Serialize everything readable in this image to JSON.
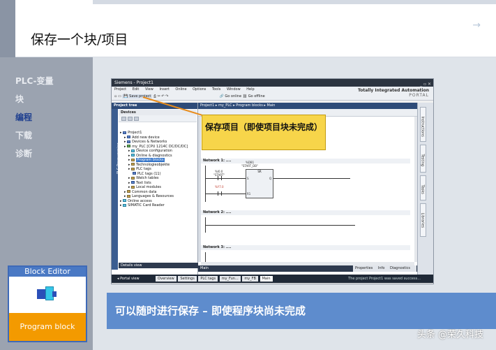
{
  "slide": {
    "title": "保存一个块/项目",
    "caption": "可以随时进行保存 – 即使程序块尚未完成",
    "watermark": "头条 @荣久科技"
  },
  "nav": {
    "items": [
      {
        "label": "PLC-变量",
        "active": false
      },
      {
        "label": "块",
        "active": false
      },
      {
        "label": "编程",
        "active": true
      },
      {
        "label": "下载",
        "active": false
      },
      {
        "label": "诊断",
        "active": false
      }
    ]
  },
  "block_card": {
    "title": "Block  Editor",
    "footer": "Program block"
  },
  "callout": {
    "text": "保存项目（即使项目块未完成）"
  },
  "tia": {
    "window_title": "Siemens - Project1",
    "menu": [
      "Project",
      "Edit",
      "View",
      "Insert",
      "Online",
      "Options",
      "Tools",
      "Window",
      "Help"
    ],
    "brand_line1": "Totally Integrated Automation",
    "brand_line2": "PORTAL",
    "toolbar": {
      "save_project": "Save project",
      "go_online": "Go online",
      "go_offline": "Go offline"
    },
    "project_tree_header": "Project tree",
    "devices_header": "Devices",
    "left_vertical_tab": "PLC Programming",
    "tree": [
      {
        "label": "Project1",
        "indent": 0,
        "icon": "b",
        "selected": false
      },
      {
        "label": "Add new device",
        "indent": 1,
        "icon": "b",
        "selected": false
      },
      {
        "label": "Devices & Networks",
        "indent": 1,
        "icon": "b",
        "selected": false
      },
      {
        "label": "my_PLC [CPU 1214C DC/DC/DC]",
        "indent": 1,
        "icon": "g",
        "selected": false
      },
      {
        "label": "Device configuration",
        "indent": 2,
        "icon": "c",
        "selected": false
      },
      {
        "label": "Online & diagnostics",
        "indent": 2,
        "icon": "c",
        "selected": false
      },
      {
        "label": "Program blocks",
        "indent": 2,
        "icon": "y",
        "selected": true
      },
      {
        "label": "Technologieobjekte",
        "indent": 2,
        "icon": "y",
        "selected": false
      },
      {
        "label": "PLC tags",
        "indent": 2,
        "icon": "y",
        "selected": false
      },
      {
        "label": "PLC tags (11)",
        "indent": 3,
        "icon": "b",
        "selected": false
      },
      {
        "label": "Watch tables",
        "indent": 2,
        "icon": "y",
        "selected": false
      },
      {
        "label": "Text lists",
        "indent": 2,
        "icon": "b",
        "selected": false
      },
      {
        "label": "Local modules",
        "indent": 2,
        "icon": "y",
        "selected": false
      },
      {
        "label": "Common data",
        "indent": 1,
        "icon": "y",
        "selected": false
      },
      {
        "label": "Languages & Resources",
        "indent": 1,
        "icon": "y",
        "selected": false
      },
      {
        "label": "Online access",
        "indent": 0,
        "icon": "c",
        "selected": false
      },
      {
        "label": "SIMATIC Card Reader",
        "indent": 0,
        "icon": "c",
        "selected": false
      }
    ],
    "details_view": "Details view",
    "breadcrumb": "Project1 ▸ my_PLC ▸ Program blocks ▸ Main",
    "network1": "Network 1:",
    "network1_suffix": "....",
    "network2": "Network 2:",
    "network2_suffix": "....",
    "network3": "Network 3:",
    "network3_suffix": "....",
    "ladder": {
      "contact1_addr": "%I0.0",
      "contact1_name": "\"START\"",
      "contact2_addr": "%Y7.0",
      "coil_addr": "%DB1",
      "coil_name": "\"START_DB\"",
      "box_type": "SR",
      "pin_s": "S",
      "pin_r": "R1",
      "pin_q": "Q"
    },
    "main_tab": "Main",
    "inspector_tabs": [
      "Properties",
      "Info",
      "Diagnostics"
    ],
    "right_tabs": [
      "Instructions",
      "Testing",
      "Tasks",
      "Libraries"
    ],
    "status_tabs": [
      "Overview",
      "Settings",
      "PLC tags",
      "my_Fun...",
      "my_FB",
      "Main"
    ],
    "portal_view": "◂ Portal view",
    "status_message": "The project Project1 was saved success..."
  }
}
